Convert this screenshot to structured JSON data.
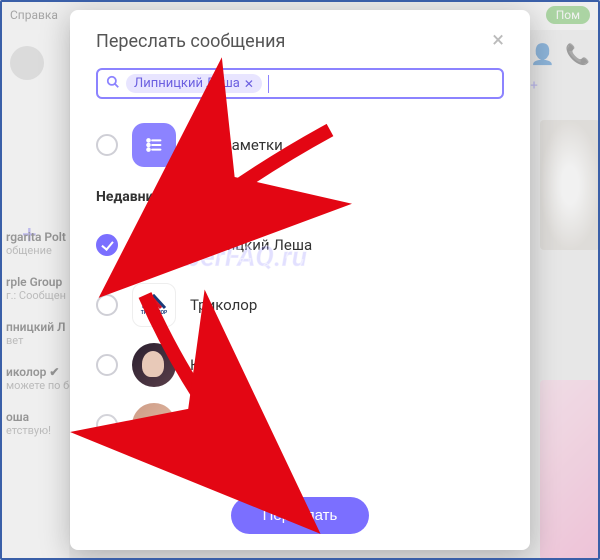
{
  "background": {
    "help_label": "Справка",
    "top_pill": "Пом",
    "plus": "+",
    "icons": {
      "add_user": "+",
      "call": "☎"
    },
    "chats": [
      {
        "name": "rgarita Polt",
        "sub": "общение"
      },
      {
        "name": "rple Group",
        "sub": "г.: Сообщен"
      },
      {
        "name": "пницкий Л",
        "sub": "вет"
      },
      {
        "name": "иколор ✔",
        "sub": "можете по бой день"
      },
      {
        "name": "оша",
        "sub": "етствую!"
      }
    ]
  },
  "modal": {
    "title": "Переслать сообщения",
    "search": {
      "chip_label": "Липницкий Леша",
      "placeholder": ""
    },
    "notes_label": "Мои заметки",
    "recent_heading": "Недавние",
    "contacts": [
      {
        "label": "Липницкий Леша",
        "checked": true,
        "avatar": "person"
      },
      {
        "label": "Триколор",
        "checked": false,
        "avatar": "tricolor"
      },
      {
        "label": "Ксюша",
        "checked": false,
        "avatar": "photo1"
      },
      {
        "label": "",
        "checked": false,
        "avatar": "photo2"
      }
    ],
    "send_button": "Переслать"
  },
  "watermark": "ViberFAQ.ru",
  "tricolor_logo_text": "ТРИКОЛОР"
}
